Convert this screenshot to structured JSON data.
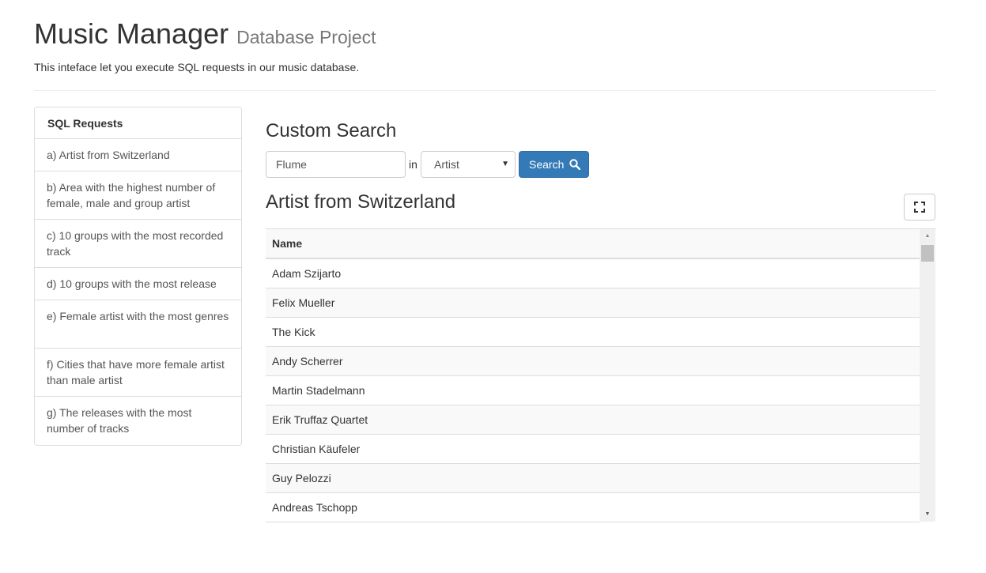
{
  "header": {
    "title": "Music Manager",
    "subtitle": "Database Project",
    "description": "This inteface let you execute SQL requests in our music database."
  },
  "sidebar": {
    "heading": "SQL Requests",
    "items": [
      {
        "label": "a) Artist from Switzerland"
      },
      {
        "label": "b) Area with the highest number of female, male and group artist"
      },
      {
        "label": "c) 10 groups with the most recorded track"
      },
      {
        "label": "d) 10 groups with the most release"
      },
      {
        "label": "e) Female artist with the most genres"
      },
      {
        "label": "f) Cities that have more female artist than male artist"
      },
      {
        "label": "g) The releases with the most number of tracks"
      }
    ]
  },
  "search": {
    "title": "Custom Search",
    "input_value": "Flume",
    "in_label": "in",
    "select_value": "Artist",
    "button_label": "Search",
    "icon": "search-icon"
  },
  "results": {
    "title": "Artist from Switzerland",
    "expand_icon": "expand-icon",
    "columns": [
      "Name"
    ],
    "rows": [
      "Adam Szijarto",
      "Felix Mueller",
      "The Kick",
      "Andy Scherrer",
      "Martin Stadelmann",
      "Erik Truffaz Quartet",
      "Christian Käufeler",
      "Guy Pelozzi",
      "Andreas Tschopp"
    ]
  },
  "colors": {
    "primary": "#337ab7",
    "border": "#dddddd",
    "stripe": "#f9f9f9"
  }
}
